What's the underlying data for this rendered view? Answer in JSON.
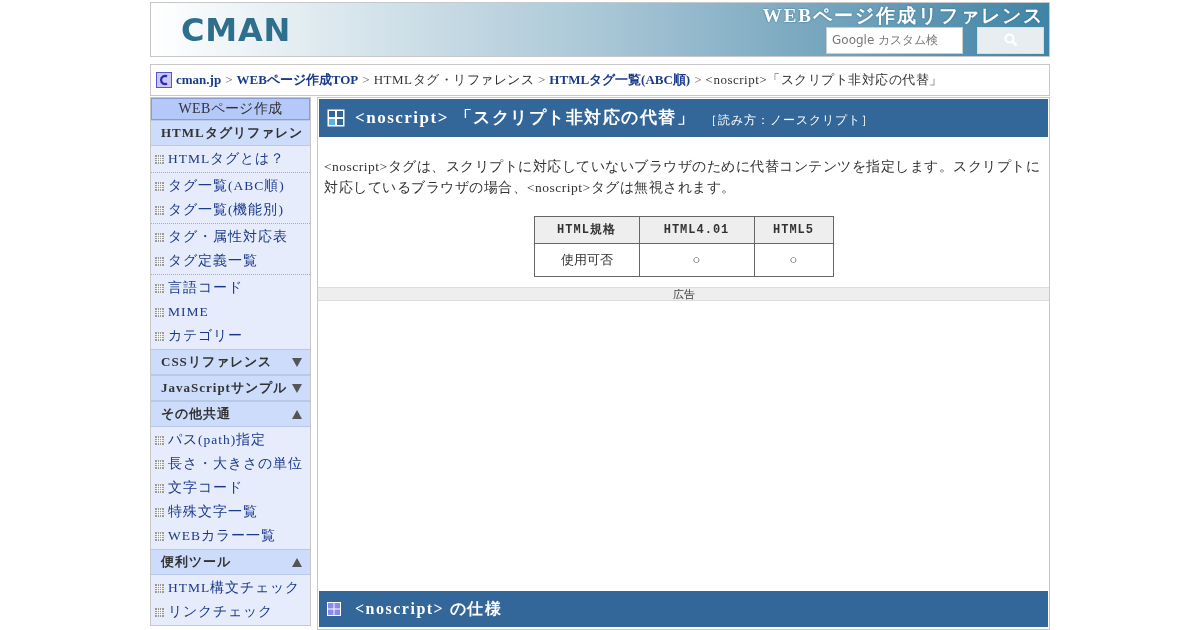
{
  "header": {
    "logo": "CMAN",
    "site_title": "WEBページ作成リファレンス",
    "search": {
      "placeholder": "Google カスタム検"
    }
  },
  "breadcrumb": [
    {
      "label": "cman.jp",
      "kind": "link"
    },
    {
      "label": ">",
      "kind": "separator"
    },
    {
      "label": "WEBページ作成TOP",
      "kind": "link"
    },
    {
      "label": ">",
      "kind": "separator"
    },
    {
      "label": "HTMLタグ・リファレンス",
      "kind": "text"
    },
    {
      "label": ">",
      "kind": "separator"
    },
    {
      "label": "HTMLタグ一覧(ABC順)",
      "kind": "link"
    },
    {
      "label": ">",
      "kind": "separator"
    },
    {
      "label": "<noscript>「スクリプト非対応の代替」",
      "kind": "text"
    }
  ],
  "sidebar": {
    "title": "WEBページ作成",
    "sections": [
      {
        "label": "HTMLタグリファレン",
        "expanded": true,
        "groups": [
          [
            "HTMLタグとは？"
          ],
          [
            "タグ一覧(ABC順)",
            "タグ一覧(機能別)"
          ],
          [
            "タグ・属性対応表",
            "タグ定義一覧"
          ],
          [
            "言語コード",
            "MIME",
            "カテゴリー"
          ]
        ]
      },
      {
        "label": "CSSリファレンス",
        "expanded": false
      },
      {
        "label": "JavaScriptサンプル",
        "expanded": false
      },
      {
        "label": "その他共通",
        "expanded": true,
        "groups": [
          [
            "パス(path)指定",
            "長さ・大きさの単位",
            "文字コード",
            "特殊文字一覧",
            "WEBカラー一覧"
          ]
        ]
      },
      {
        "label": "便利ツール",
        "expanded": true,
        "groups": [
          [
            "HTML構文チェック",
            "リンクチェック"
          ]
        ]
      }
    ]
  },
  "article": {
    "title": "<noscript> 「スクリプト非対応の代替」",
    "reading": "［読み方：ノースクリプト］",
    "description": "<noscript>タグは、スクリプトに対応していないブラウザのために代替コンテンツを指定します。スクリプトに対応しているブラウザの場合、<noscript>タグは無視されます。",
    "table": {
      "columns": [
        "HTML規格",
        "HTML4.01",
        "HTML5"
      ],
      "rows": [
        [
          "使用可否",
          "○",
          "○"
        ]
      ]
    },
    "ad_label": "広告",
    "section_title": "<noscript> の仕様"
  }
}
